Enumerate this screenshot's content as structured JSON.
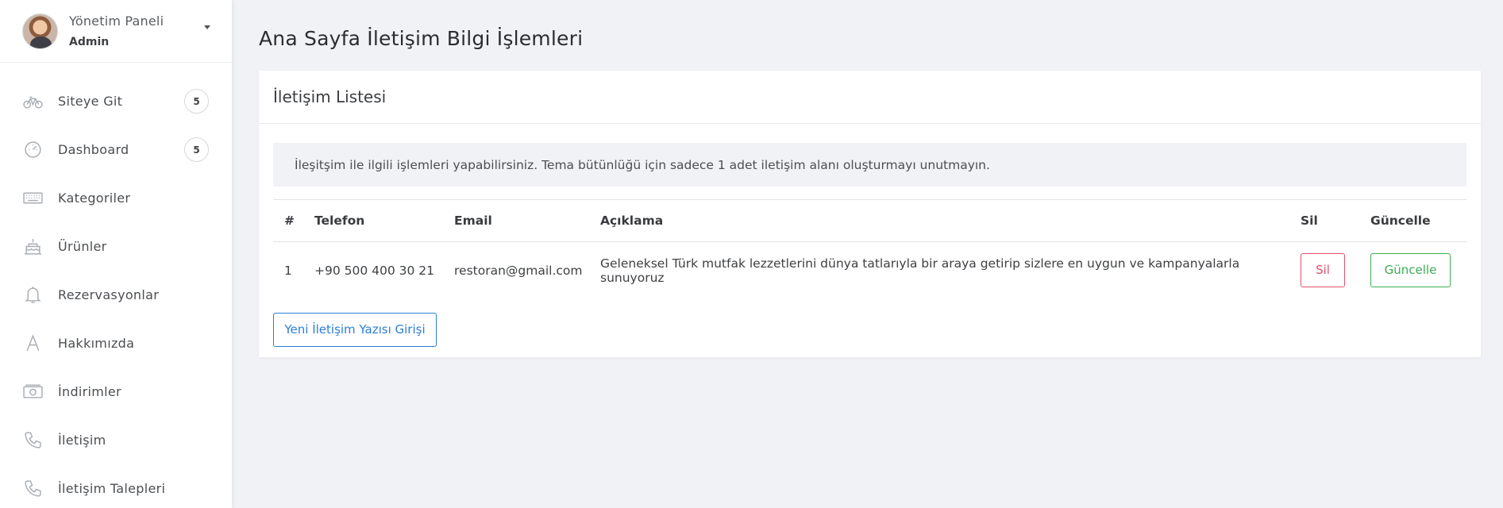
{
  "sidebar": {
    "profile": {
      "title": "Yönetim Paneli",
      "role": "Admin"
    },
    "items": [
      {
        "label": "Siteye Git",
        "icon": "bicycle-icon",
        "badge": "5"
      },
      {
        "label": "Dashboard",
        "icon": "gauge-icon",
        "badge": "5"
      },
      {
        "label": "Kategoriler",
        "icon": "keyboard-icon"
      },
      {
        "label": "Ürünler",
        "icon": "cake-icon"
      },
      {
        "label": "Rezervasyonlar",
        "icon": "bell-icon"
      },
      {
        "label": "Hakkımızda",
        "icon": "letter-a-icon"
      },
      {
        "label": "İndirimler",
        "icon": "money-icon"
      },
      {
        "label": "İletişim",
        "icon": "phone-icon"
      },
      {
        "label": "İletişim Talepleri",
        "icon": "phone-icon"
      }
    ]
  },
  "page": {
    "title": "Ana Sayfa İletişim Bilgi İşlemleri"
  },
  "card": {
    "title": "İletişim Listesi",
    "info": "İleşitşim ile ilgili işlemleri yapabilirsiniz. Tema bütünlüğü için sadece 1 adet iletişim alanı oluşturmayı unutmayın.",
    "table": {
      "headers": [
        "#",
        "Telefon",
        "Email",
        "Açıklama",
        "Sil",
        "Güncelle"
      ],
      "rows": [
        {
          "num": "1",
          "telefon": "+90 500 400 30 21",
          "email": "restoran@gmail.com",
          "aciklama": "Geleneksel Türk mutfak lezzetlerini dünya tatlarıyla bir araya getirip sizlere en uygun ve kampanyalarla sunuyoruz",
          "sil_label": "Sil",
          "guncelle_label": "Güncelle"
        }
      ]
    },
    "new_button": "Yeni İletişim Yazısı Girişi"
  },
  "colors": {
    "danger": "#e3506b",
    "success": "#3cae54",
    "primary": "#2a7fd6",
    "background": "#f1f2f6"
  }
}
